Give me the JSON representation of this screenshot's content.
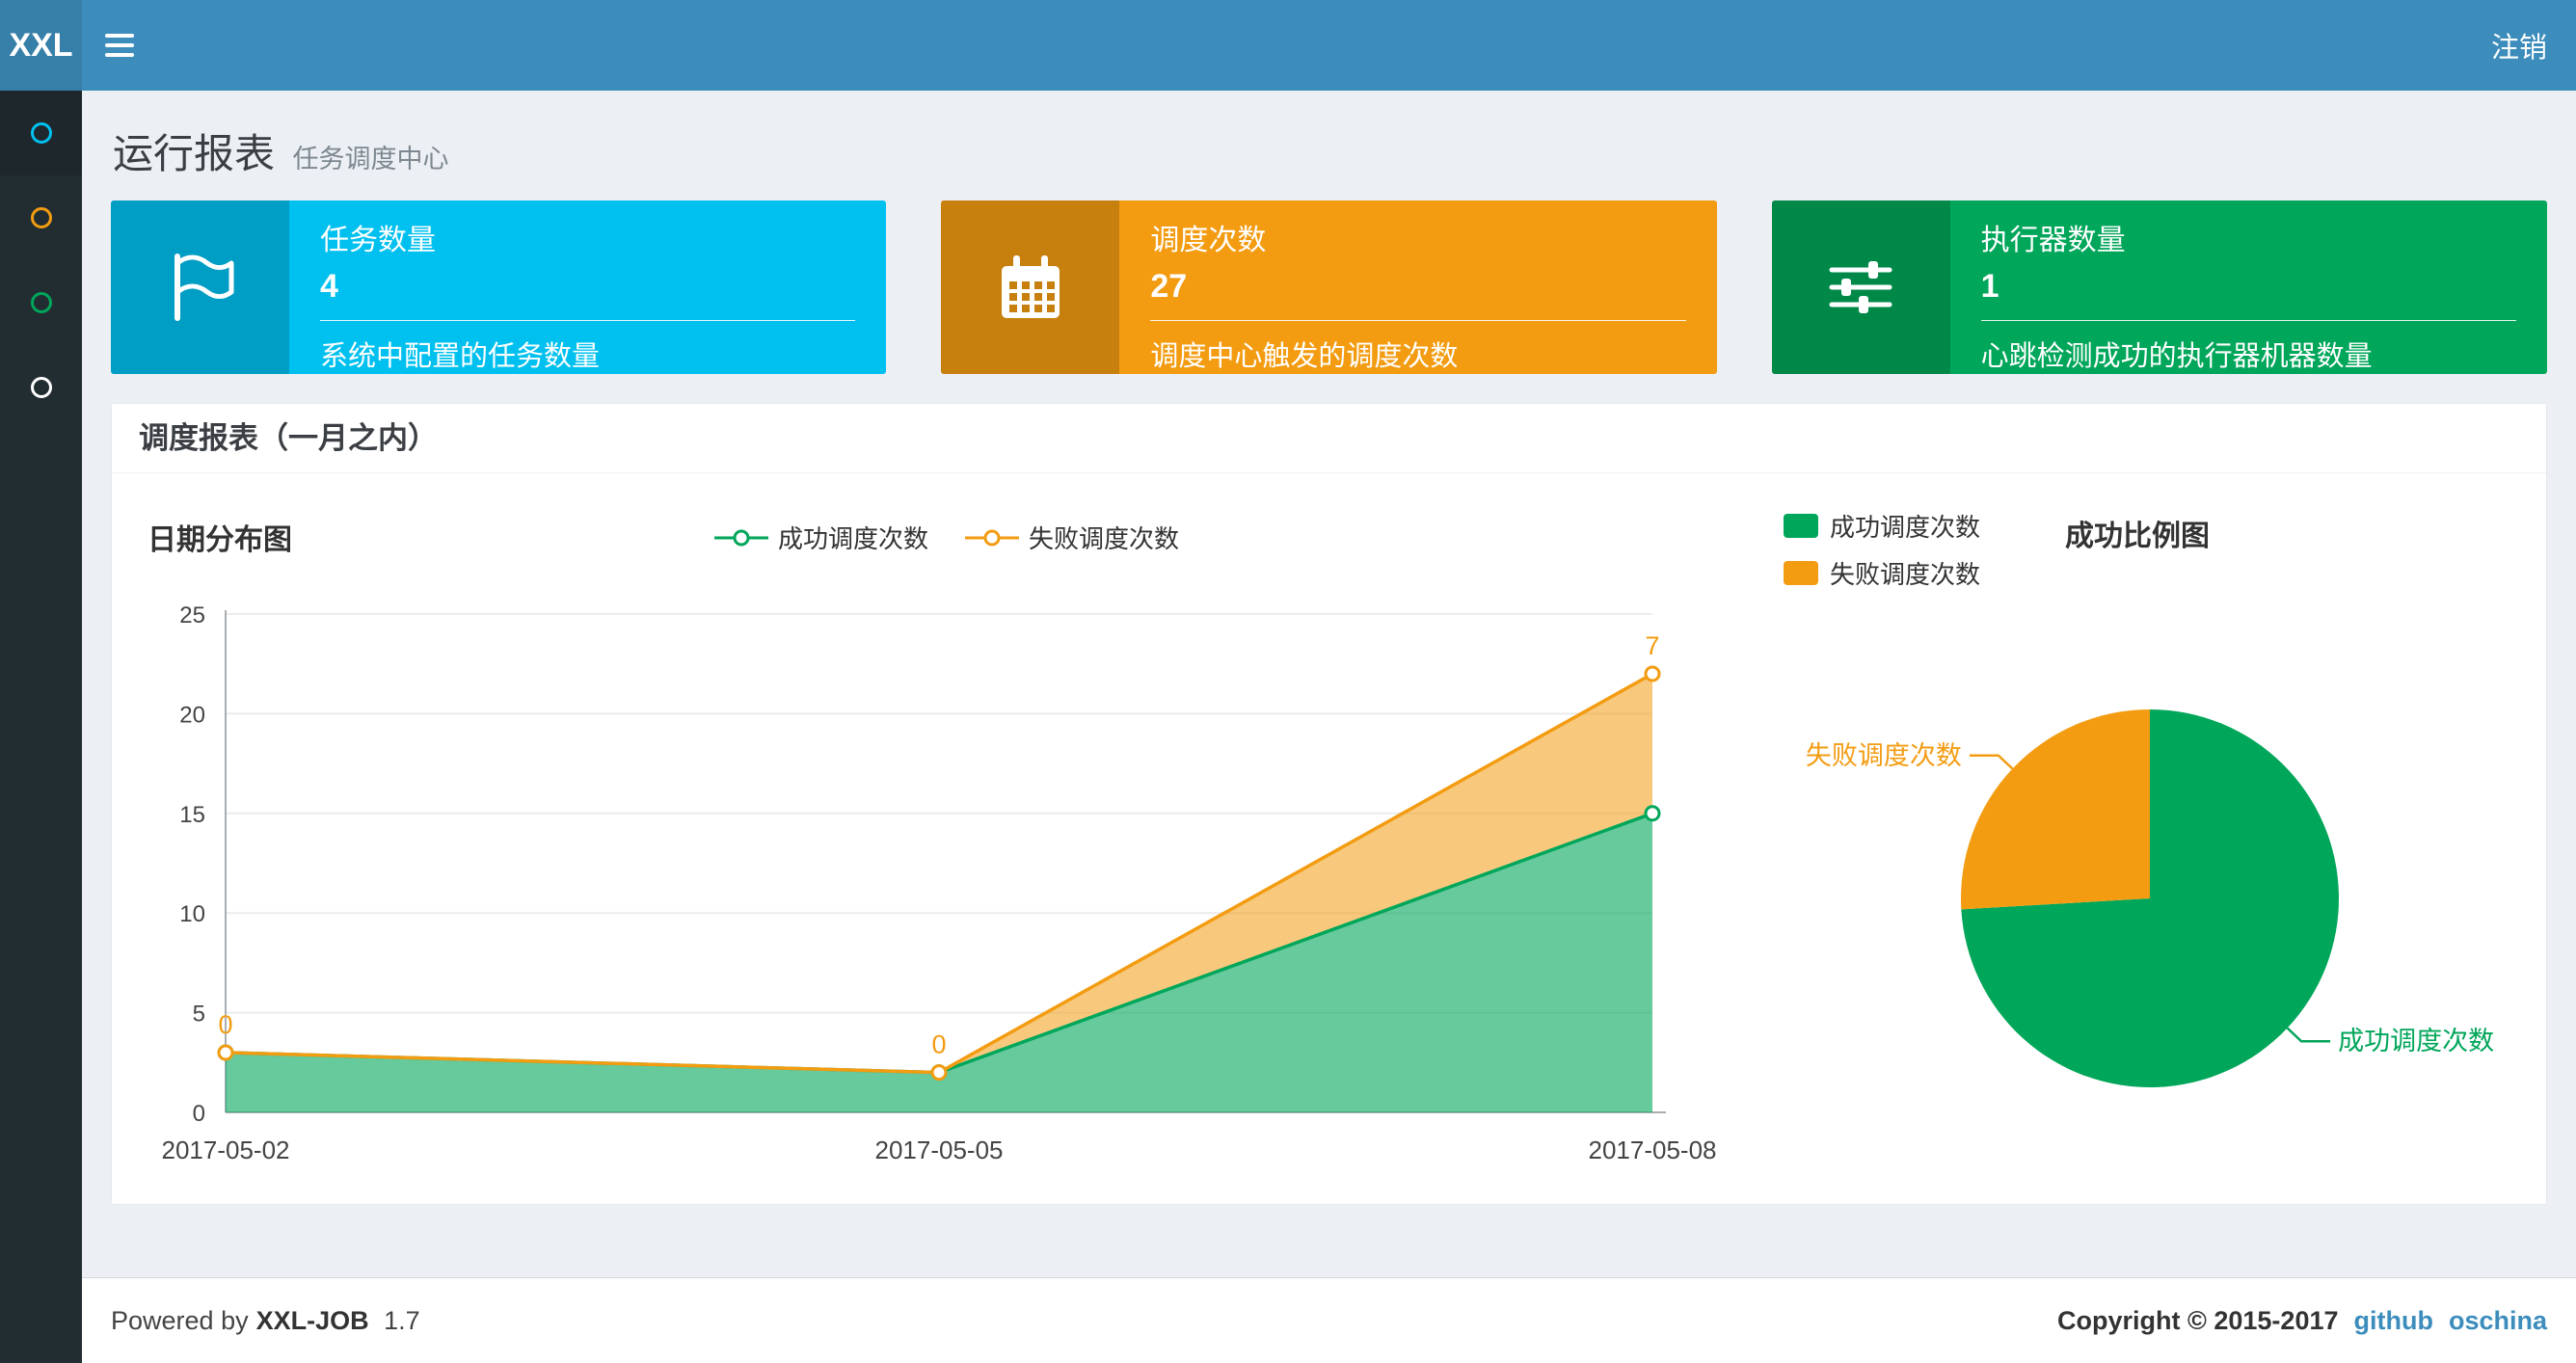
{
  "navbar": {
    "logo": "XXL",
    "logout": "注销"
  },
  "sidebar": {
    "items": [
      {
        "name": "menu-report",
        "color": "#00c0ef"
      },
      {
        "name": "menu-job",
        "color": "#f39c12"
      },
      {
        "name": "menu-log",
        "color": "#00a65a"
      },
      {
        "name": "menu-executor",
        "color": "#ffffff"
      }
    ]
  },
  "page": {
    "title": "运行报表",
    "subtitle": "任务调度中心"
  },
  "info_boxes": [
    {
      "title": "任务数量",
      "value": "4",
      "desc": "系统中配置的任务数量",
      "color": "#00c0ef",
      "icon": "flag-icon"
    },
    {
      "title": "调度次数",
      "value": "27",
      "desc": "调度中心触发的调度次数",
      "color": "#f39c12",
      "icon": "calendar-icon"
    },
    {
      "title": "执行器数量",
      "value": "1",
      "desc": "心跳检测成功的执行器机器数量",
      "color": "#00a65a",
      "icon": "sliders-icon"
    }
  ],
  "panel": {
    "title": "调度报表（一月之内）"
  },
  "chart_data": [
    {
      "type": "area",
      "title": "日期分布图",
      "categories": [
        "2017-05-02",
        "2017-05-05",
        "2017-05-08"
      ],
      "series": [
        {
          "name": "成功调度次数",
          "color": "#00a65a",
          "values": [
            3,
            2,
            15
          ]
        },
        {
          "name": "失败调度次数",
          "color": "#f39c12",
          "values": [
            0,
            0,
            7
          ]
        }
      ],
      "stacked": true,
      "ylim": [
        0,
        25
      ],
      "yticks": [
        0,
        5,
        10,
        15,
        20,
        25
      ],
      "point_labels": [
        0,
        0,
        7
      ],
      "legend_position": "top",
      "grid": true
    },
    {
      "type": "pie",
      "title": "成功比例图",
      "slices": [
        {
          "name": "成功调度次数",
          "value": 20,
          "color": "#00a65a"
        },
        {
          "name": "失败调度次数",
          "value": 7,
          "color": "#f39c12"
        }
      ],
      "legend_position": "top-left"
    }
  ],
  "footer": {
    "powered_prefix": "Powered by",
    "product": "XXL-JOB",
    "version": "1.7",
    "copyright": "Copyright © 2015-2017",
    "links": [
      "github",
      "oschina"
    ]
  }
}
